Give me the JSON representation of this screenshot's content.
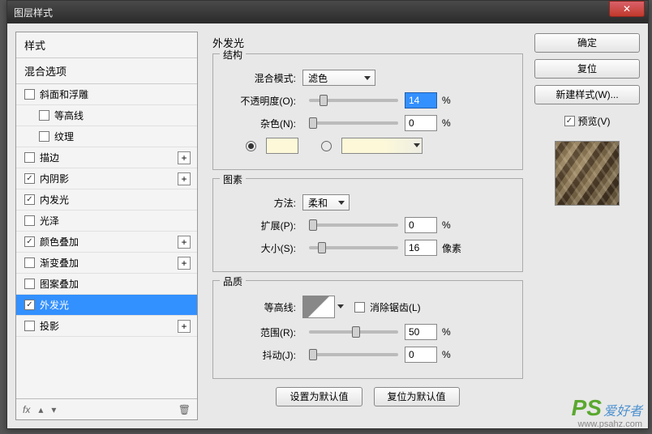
{
  "window": {
    "title": "图层样式"
  },
  "sidebar": {
    "header": "样式",
    "sub": "混合选项",
    "items": [
      {
        "label": "斜面和浮雕",
        "checked": false,
        "plus": false,
        "indent": false
      },
      {
        "label": "等高线",
        "checked": false,
        "plus": false,
        "indent": true
      },
      {
        "label": "纹理",
        "checked": false,
        "plus": false,
        "indent": true
      },
      {
        "label": "描边",
        "checked": false,
        "plus": true,
        "indent": false
      },
      {
        "label": "内阴影",
        "checked": true,
        "plus": true,
        "indent": false
      },
      {
        "label": "内发光",
        "checked": true,
        "plus": false,
        "indent": false
      },
      {
        "label": "光泽",
        "checked": false,
        "plus": false,
        "indent": false
      },
      {
        "label": "颜色叠加",
        "checked": true,
        "plus": true,
        "indent": false
      },
      {
        "label": "渐变叠加",
        "checked": false,
        "plus": true,
        "indent": false
      },
      {
        "label": "图案叠加",
        "checked": false,
        "plus": false,
        "indent": false
      },
      {
        "label": "外发光",
        "checked": true,
        "plus": false,
        "indent": false,
        "selected": true
      },
      {
        "label": "投影",
        "checked": false,
        "plus": true,
        "indent": false
      }
    ]
  },
  "main": {
    "title": "外发光",
    "structure": {
      "title": "结构",
      "blend_label": "混合模式:",
      "blend_value": "滤色",
      "opacity_label": "不透明度(O):",
      "opacity_value": "14",
      "opacity_unit": "%",
      "noise_label": "杂色(N):",
      "noise_value": "0",
      "noise_unit": "%"
    },
    "elements": {
      "title": "图素",
      "method_label": "方法:",
      "method_value": "柔和",
      "spread_label": "扩展(P):",
      "spread_value": "0",
      "spread_unit": "%",
      "size_label": "大小(S):",
      "size_value": "16",
      "size_unit": "像素"
    },
    "quality": {
      "title": "品质",
      "contour_label": "等高线:",
      "antialias_label": "消除锯齿(L)",
      "range_label": "范围(R):",
      "range_value": "50",
      "range_unit": "%",
      "jitter_label": "抖动(J):",
      "jitter_value": "0",
      "jitter_unit": "%"
    },
    "buttons": {
      "make_default": "设置为默认值",
      "reset_default": "复位为默认值"
    }
  },
  "right": {
    "ok": "确定",
    "reset": "复位",
    "new_style": "新建样式(W)...",
    "preview_label": "预览(V)"
  },
  "watermark": {
    "ps": "PS",
    "txt": "爱好者",
    "url": "www.psahz.com"
  }
}
